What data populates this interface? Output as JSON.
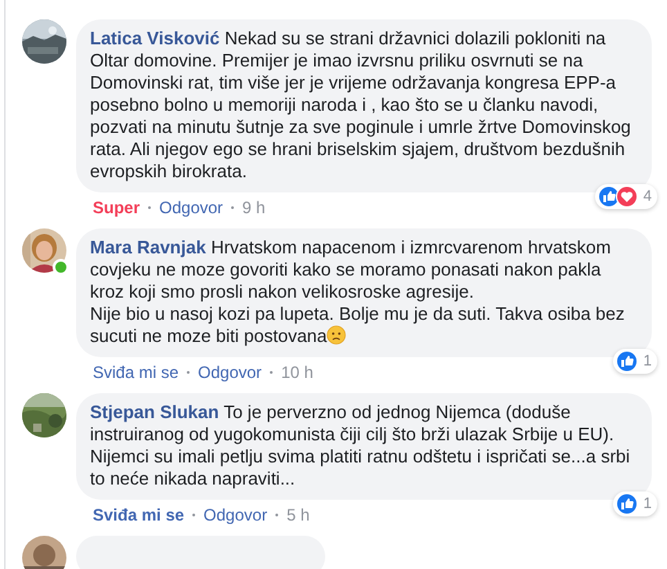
{
  "comments": [
    {
      "author": "Latica Visković",
      "text": "Nekad su se strani državnici dolazili pokloniti na Oltar domovine. Premijer je imao izvrsnu priliku osvrnuti se na Domovinski rat, tim više jer je vrijeme održavanja kongresa EPP-a posebno bolno u memoriji naroda i , kao što se u članku navodi, pozvati na minutu šutnje za sve poginule i umrle žrtve Domovinskog rata. Ali njegov ego se hrani briselskim sjajem, društvom bezdušnih evropskih birokrata.",
      "online": false,
      "emoji": false,
      "my_reaction": {
        "kind": "love",
        "label": "Super"
      },
      "reply": "Odgovor",
      "time": "9 h",
      "reactions": {
        "icons": [
          {
            "kind": "like"
          },
          {
            "kind": "love"
          }
        ],
        "count": "4"
      }
    },
    {
      "author": "Mara Ravnjak",
      "text": "Hrvatskom napacenom i izmrcvarenom hrvatskom covjeku ne moze govoriti kako se moramo ponasati nakon pakla kroz koji smo prosli nakon velikosroske agresije.\nNije bio u nasoj kozi pa lupeta. Bolje mu je da suti. Takva osiba bez sucuti ne moze biti postovana",
      "online": true,
      "emoji": true,
      "my_reaction": {
        "kind": "none",
        "label": "Sviđa mi se"
      },
      "reply": "Odgovor",
      "time": "10 h",
      "reactions": {
        "icons": [
          {
            "kind": "like"
          }
        ],
        "count": "1"
      }
    },
    {
      "author": "Stjepan Slukan",
      "text": "To je perverzno od jednog Nijemca (doduše instruiranog od yugokomunista čiji cilj što brži ulazak Srbije u EU). Nijemci su imali petlju svima platiti ratnu odštetu i ispričati se...a srbi to neće nikada napraviti...",
      "online": false,
      "emoji": false,
      "my_reaction": {
        "kind": "like",
        "label": "Sviđa mi se"
      },
      "reply": "Odgovor",
      "time": "5 h",
      "reactions": {
        "icons": [
          {
            "kind": "like"
          }
        ],
        "count": "1"
      }
    }
  ]
}
